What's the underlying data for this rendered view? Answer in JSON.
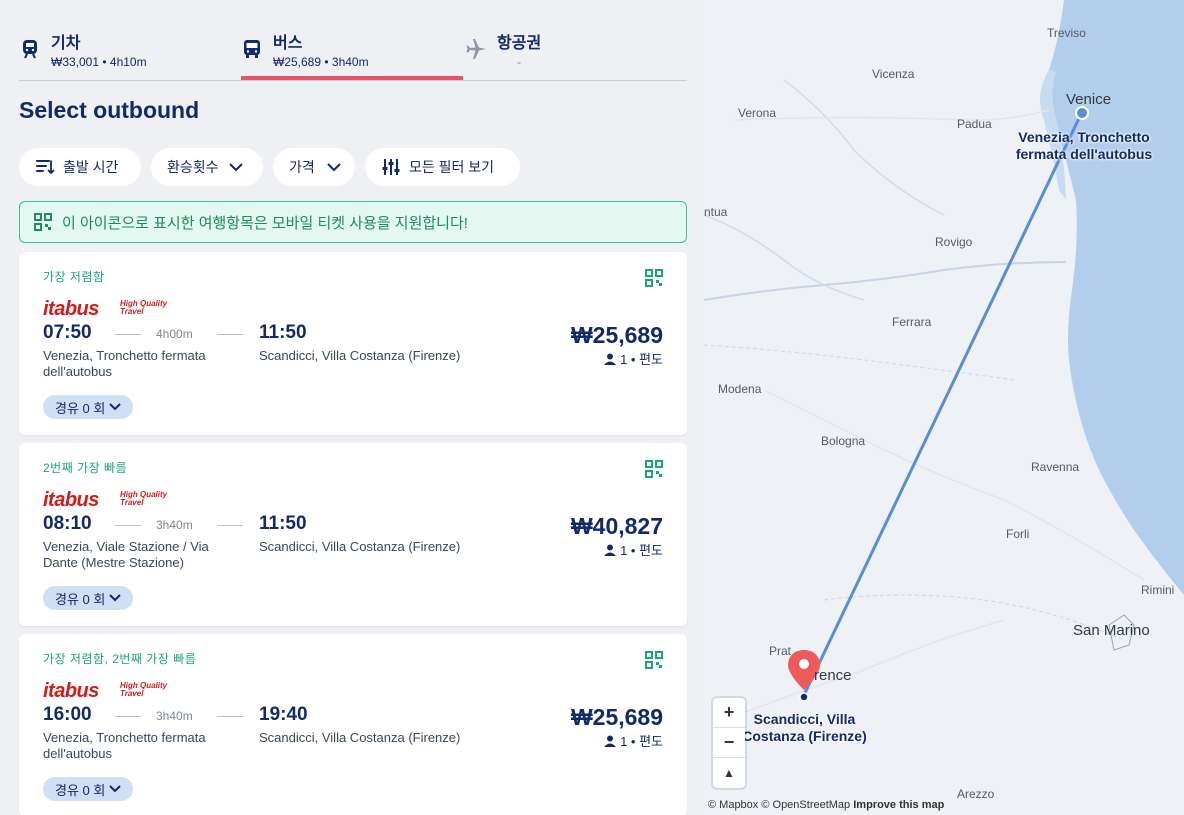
{
  "modes": [
    {
      "name": "기차",
      "sub": "₩33,001 • 4h10m",
      "icon": "train-icon"
    },
    {
      "name": "버스",
      "sub": "₩25,689 • 3h40m",
      "icon": "bus-icon",
      "selected": true
    },
    {
      "name": "항공권",
      "sub": "-",
      "icon": "plane-icon"
    }
  ],
  "title": "Select outbound",
  "filters": {
    "sort": "출발 시간",
    "transfers": "환승횟수",
    "price": "가격",
    "all_filters": "모든 필터 보기"
  },
  "notice": "이 아이콘으로 표시한 여행항목은 모바일 티켓 사용을 지원합니다!",
  "results": [
    {
      "tag": "가장 저렴함",
      "operator": "itabus",
      "operator_tagline": "High Quality Travel",
      "departure_time": "07:50",
      "duration": "4h00m",
      "arrival_time": "11:50",
      "departure_station": "Venezia, Tronchetto fermata dell'autobus",
      "arrival_station": "Scandicci, Villa Costanza (Firenze)",
      "price": "₩25,689",
      "pax": "1 • 편도",
      "stops": "경유 0 회"
    },
    {
      "tag": "2번째 가장 빠름",
      "operator": "itabus",
      "operator_tagline": "High Quality Travel",
      "departure_time": "08:10",
      "duration": "3h40m",
      "arrival_time": "11:50",
      "departure_station": "Venezia, Viale Stazione / Via Dante (Mestre Stazione)",
      "arrival_station": "Scandicci, Villa Costanza (Firenze)",
      "price": "₩40,827",
      "pax": "1 • 편도",
      "stops": "경유 0 회"
    },
    {
      "tag": "가장 저렴함, 2번째 가장 빠름",
      "operator": "itabus",
      "operator_tagline": "High Quality Travel",
      "departure_time": "16:00",
      "duration": "3h40m",
      "arrival_time": "19:40",
      "departure_station": "Venezia, Tronchetto fermata dell'autobus",
      "arrival_station": "Scandicci, Villa Costanza (Firenze)",
      "price": "₩25,689",
      "pax": "1 • 편도",
      "stops": "경유 0 회"
    }
  ],
  "map": {
    "cities": [
      "Treviso",
      "Vicenza",
      "Venice",
      "Verona",
      "Padua",
      "ntua",
      "Rovigo",
      "Ferrara",
      "Modena",
      "Bologna",
      "Ravenna",
      "Forli",
      "Rimini",
      "San Marino",
      "Prat",
      "rence",
      "Arezzo"
    ],
    "origin_label": "Venezia, Tronchetto fermata dell'autobus",
    "destination_label": "Scandicci, Villa Costanza (Firenze)",
    "zoom_in": "+",
    "zoom_out": "−",
    "compass": "▲",
    "attribution": "© Mapbox © OpenStreetMap",
    "improve": "Improve this map"
  },
  "colors": {
    "primary": "#132968",
    "accent_red": "#e85464",
    "green": "#1ba474",
    "route": "#5b8dd2",
    "sea": "#b3cdec"
  }
}
